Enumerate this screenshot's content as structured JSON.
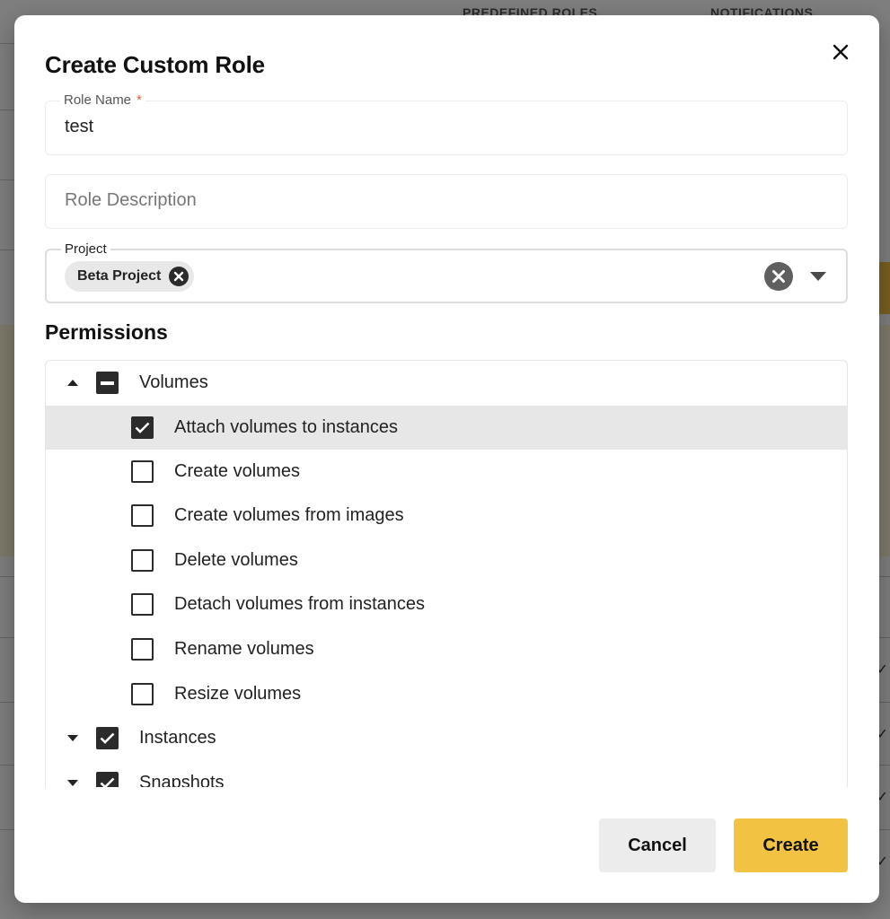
{
  "dialog": {
    "title": "Create Custom Role",
    "close_icon": "close-icon"
  },
  "role_name": {
    "label": "Role Name",
    "required_mark": "*",
    "value": "test"
  },
  "role_description": {
    "placeholder": "Role Description",
    "value": ""
  },
  "project": {
    "label": "Project",
    "selected_chips": [
      {
        "label": "Beta Project"
      }
    ]
  },
  "permissions": {
    "title": "Permissions",
    "groups": [
      {
        "label": "Volumes",
        "state": "indeterminate",
        "expanded": true,
        "items": [
          {
            "label": "Attach volumes to instances",
            "checked": true,
            "highlighted": true
          },
          {
            "label": "Create volumes",
            "checked": false
          },
          {
            "label": "Create volumes from images",
            "checked": false
          },
          {
            "label": "Delete volumes",
            "checked": false
          },
          {
            "label": "Detach volumes from instances",
            "checked": false
          },
          {
            "label": "Rename volumes",
            "checked": false
          },
          {
            "label": "Resize volumes",
            "checked": false
          }
        ]
      },
      {
        "label": "Instances",
        "state": "checked",
        "expanded": false
      },
      {
        "label": "Snapshots",
        "state": "checked",
        "expanded": false
      }
    ]
  },
  "actions": {
    "cancel_label": "Cancel",
    "create_label": "Create"
  },
  "background": {
    "column_headers": [
      "PREDEFINED ROLES",
      "NOTIFICATIONS"
    ]
  },
  "colors": {
    "accent": "#f2c242",
    "checkbox": "#2b2b2b",
    "selected_row": "#e7e7e7",
    "required": "#e05a3a"
  }
}
